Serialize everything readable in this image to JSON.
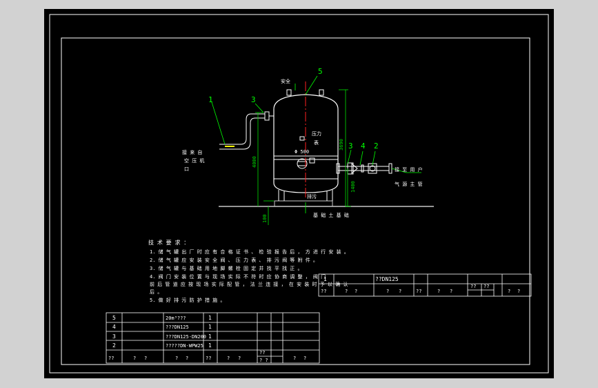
{
  "colors": {
    "frame": "#ffffff",
    "vessel": "#ffffff",
    "dimension": "#00e000",
    "centerline": "#ff2020",
    "leader": "#00ff00",
    "notes_text": "#ffffff",
    "table": "#ffffff",
    "ground": "#c8c8c8",
    "background": "#000000"
  },
  "callouts": {
    "c1": "1",
    "c2": "2",
    "c3_left": "3",
    "c3_right": "3",
    "c4": "4",
    "c5": "5"
  },
  "labels": {
    "safety": "安全",
    "pressure": "压力",
    "pressure_sub": "表",
    "air_inlet_1": "接 来 自",
    "air_inlet_2": "空 压 机",
    "air_inlet_3": "口",
    "outlet_1": "接 至 用 户",
    "outlet_2": "气 源 主 管",
    "drain": "排污",
    "foundation": "基 础 土 基 础",
    "manhole": "Φ 500"
  },
  "dimensions": {
    "total_height": "3690",
    "vessel_height": "4000",
    "outlet_height": "1400",
    "base_height": "100"
  },
  "notes": {
    "title": "技 术 要 求 ：",
    "lines": [
      "1. 储 气 罐 出 厂 时 应 有 合 格 证 书 、 检 验 报 告 后 ， 方 进 行 安 装 。",
      "2. 储 气 罐 应 安 装 安 全 阀 、 压 力 表 、 排 污 阀 等 附 件 。",
      "3. 储 气 罐 与 基 础 用 地 脚 螺 栓 固 定 并 找 平 找 正 。",
      "4. 阀 门 安 装 位 置 与 现 场 实 际 不 符 时 应 协 商 调 整 ， 阀 门",
      "前 后 管 道 应 按 现 场 实 际 配 管 ， 法 兰 连 接 ， 在 安 装 时 予 以 确 认",
      "后 。",
      "5. 做 好 排 污 防 护 措 施 。"
    ]
  },
  "table_right": {
    "row": {
      "no": "1",
      "name": "??DN125"
    },
    "header": [
      "??",
      "?",
      "?",
      "?",
      "?",
      "??",
      "?",
      "?",
      "??",
      "??",
      "?",
      "?"
    ]
  },
  "table_left": {
    "rows": [
      {
        "no": "5",
        "name": "20m³???",
        "qty": "1"
      },
      {
        "no": "4",
        "name": "???DN125",
        "qty": "1"
      },
      {
        "no": "3",
        "name": "???DN125-DN200",
        "qty": "1"
      },
      {
        "no": "2",
        "name": "?????DN-WPW25",
        "qty": "1"
      }
    ],
    "header": [
      "??",
      "?",
      "?",
      "?",
      "?",
      "??",
      "?",
      "?",
      "??",
      "? ?",
      "?",
      "?"
    ]
  }
}
